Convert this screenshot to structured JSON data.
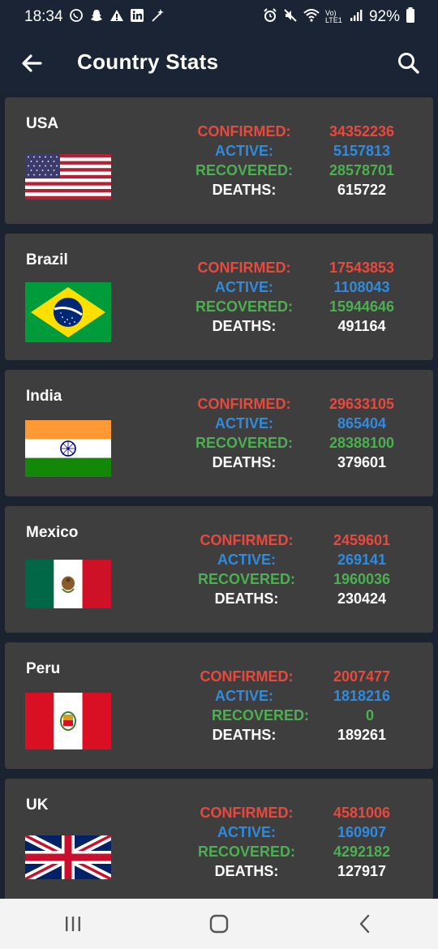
{
  "status_bar": {
    "time": "18:34",
    "battery": "92%",
    "network": "Vo) LTE1"
  },
  "app_bar": {
    "title": "Country Stats",
    "back_icon": "arrow-left-icon",
    "search_icon": "search-icon"
  },
  "labels": {
    "confirmed": "CONFIRMED:",
    "active": "ACTIVE:",
    "recovered": "RECOVERED:",
    "deaths": "DEATHS:"
  },
  "colors": {
    "confirmed": "#e9493d",
    "active": "#2f8be0",
    "recovered": "#4caf50",
    "deaths": "#ffffff",
    "card": "#3e3e3e",
    "app_bar": "#1b2434"
  },
  "countries": [
    {
      "name": "USA",
      "flag": "usa-flag",
      "confirmed": "34352236",
      "active": "5157813",
      "recovered": "28578701",
      "deaths": "615722"
    },
    {
      "name": "Brazil",
      "flag": "brazil-flag",
      "confirmed": "17543853",
      "active": "1108043",
      "recovered": "15944646",
      "deaths": "491164"
    },
    {
      "name": "India",
      "flag": "india-flag",
      "confirmed": "29633105",
      "active": "865404",
      "recovered": "28388100",
      "deaths": "379601"
    },
    {
      "name": "Mexico",
      "flag": "mexico-flag",
      "confirmed": "2459601",
      "active": "269141",
      "recovered": "1960036",
      "deaths": "230424"
    },
    {
      "name": "Peru",
      "flag": "peru-flag",
      "confirmed": "2007477",
      "active": "1818216",
      "recovered": "0",
      "deaths": "189261"
    },
    {
      "name": "UK",
      "flag": "uk-flag",
      "confirmed": "4581006",
      "active": "160907",
      "recovered": "4292182",
      "deaths": "127917"
    }
  ],
  "nav_bar": {
    "recents_icon": "recents-icon",
    "home_icon": "home-icon",
    "back_icon": "back-icon"
  }
}
